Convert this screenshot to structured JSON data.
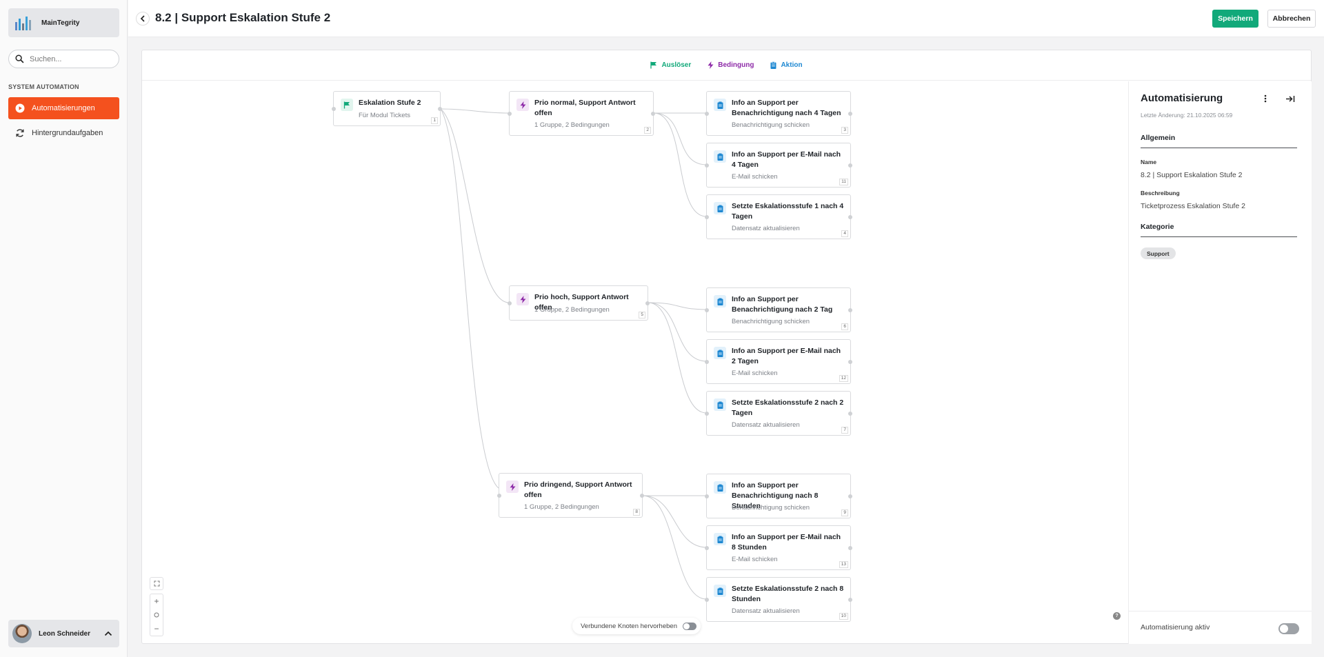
{
  "app": {
    "brand": "MainTegrity"
  },
  "search": {
    "placeholder": "Suchen..."
  },
  "sidebar": {
    "section": "SYSTEM AUTOMATION",
    "items": [
      {
        "label": "Automatisierungen",
        "icon": "play-circle-icon",
        "active": true
      },
      {
        "label": "Hintergrundaufgaben",
        "icon": "refresh-icon",
        "active": false
      }
    ]
  },
  "user": {
    "name": "Leon Schneider"
  },
  "header": {
    "title": "8.2 | Support Eskalation Stufe 2",
    "save": "Speichern",
    "cancel": "Abbrechen"
  },
  "legend": [
    {
      "label": "Auslöser",
      "color": "#12a97a",
      "icon": "flag-icon"
    },
    {
      "label": "Bedingung",
      "color": "#8e2ba8",
      "icon": "bolt-icon"
    },
    {
      "label": "Aktion",
      "color": "#1e88d2",
      "icon": "clipboard-icon"
    }
  ],
  "nodes": {
    "trigger": {
      "title": "Eskalation Stufe 2",
      "sub": "Für Modul Tickets",
      "num": "1"
    },
    "conditions": [
      {
        "title": "Prio normal, Support Antwort offen",
        "sub": "1 Gruppe, 2 Bedingungen",
        "num": "2"
      },
      {
        "title": "Prio hoch, Support Antwort offen",
        "sub": "1 Gruppe, 2 Bedingungen",
        "num": "5"
      },
      {
        "title": "Prio dringend, Support Antwort offen",
        "sub": "1 Gruppe, 2 Bedingungen",
        "num": "8"
      }
    ],
    "actions": [
      {
        "title": "Info an Support per Benachrichtigung nach 4 Tagen",
        "sub": "Benachrichtigung schicken",
        "num": "3"
      },
      {
        "title": "Info an Support per E-Mail nach 4 Tagen",
        "sub": "E-Mail schicken",
        "num": "11"
      },
      {
        "title": "Setzte Eskalationsstufe 1 nach 4 Tagen",
        "sub": "Datensatz aktualisieren",
        "num": "4"
      },
      {
        "title": "Info an Support per Benachrichtigung nach 2 Tag",
        "sub": "Benachrichtigung schicken",
        "num": "6"
      },
      {
        "title": "Info an Support per E-Mail nach 2 Tagen",
        "sub": "E-Mail schicken",
        "num": "12"
      },
      {
        "title": "Setzte Eskalationsstufe 2 nach 2 Tagen",
        "sub": "Datensatz aktualisieren",
        "num": "7"
      },
      {
        "title": "Info an Support per Benachrichtigung nach 8 Stunden",
        "sub": "Benachrichtigung schicken",
        "num": "9"
      },
      {
        "title": "Info an Support per E-Mail nach 8 Stunden",
        "sub": "E-Mail schicken",
        "num": "13"
      },
      {
        "title": "Setzte Eskalationsstufe 2 nach 8 Stunden",
        "sub": "Datensatz aktualisieren",
        "num": "10"
      }
    ]
  },
  "canvas": {
    "highlight_label": "Verbundene Knoten hervorheben",
    "help": "?"
  },
  "panel": {
    "title": "Automatisierung",
    "modified": "Letzte Änderung: 21.10.2025 06:59",
    "general": "Allgemein",
    "name_label": "Name",
    "name_value": "8.2 | Support Eskalation Stufe 2",
    "desc_label": "Beschreibung",
    "desc_value": "Ticketprozess Eskalation Stufe 2",
    "category": "Kategorie",
    "chip": "Support",
    "active_label": "Automatisierung aktiv"
  }
}
